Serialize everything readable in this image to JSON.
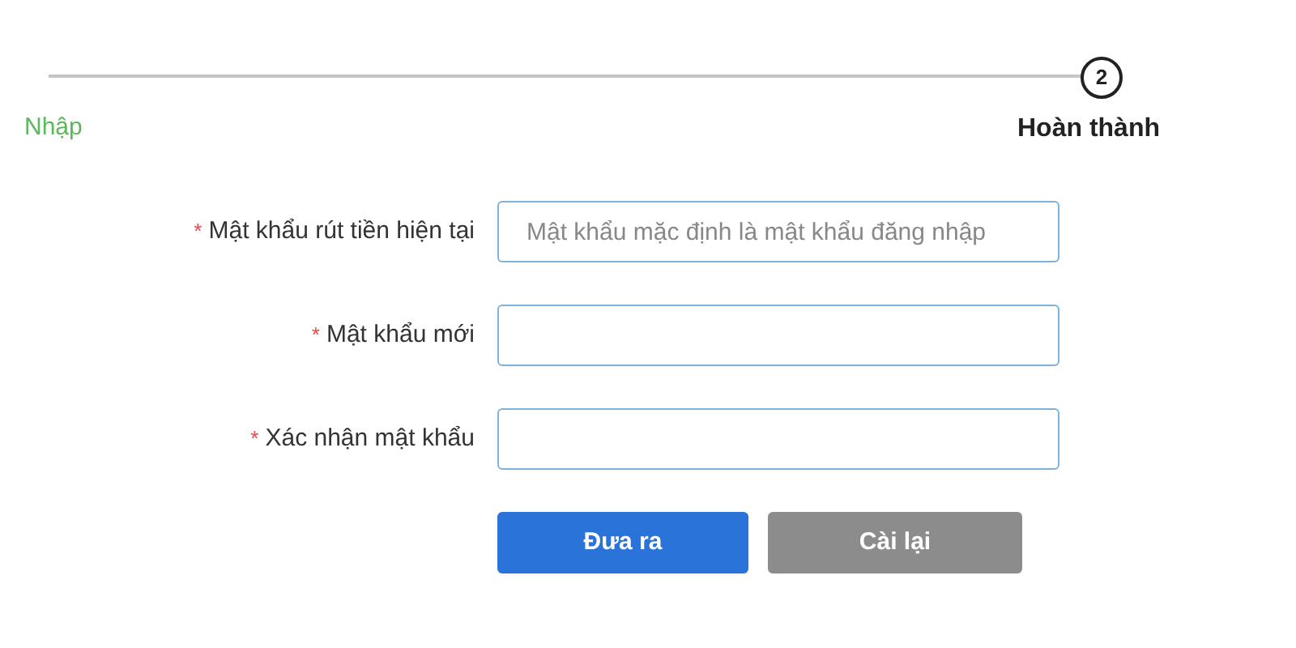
{
  "steps": [
    {
      "label": "Nhập",
      "completed": true
    },
    {
      "label": "Hoàn thành",
      "number": "2",
      "completed": false
    }
  ],
  "fields": [
    {
      "label": "Mật khẩu rút tiền hiện tại",
      "required": true,
      "placeholder": "Mật khẩu mặc định là mật khẩu đăng nhập"
    },
    {
      "label": "Mật khẩu mới",
      "required": true
    },
    {
      "label": "Xác nhận mật khẩu",
      "required": true
    }
  ],
  "required_mark": "*",
  "buttons": [
    {
      "label": "Đưa ra",
      "kind": "primary"
    },
    {
      "label": "Cài lại",
      "kind": "secondary"
    }
  ]
}
